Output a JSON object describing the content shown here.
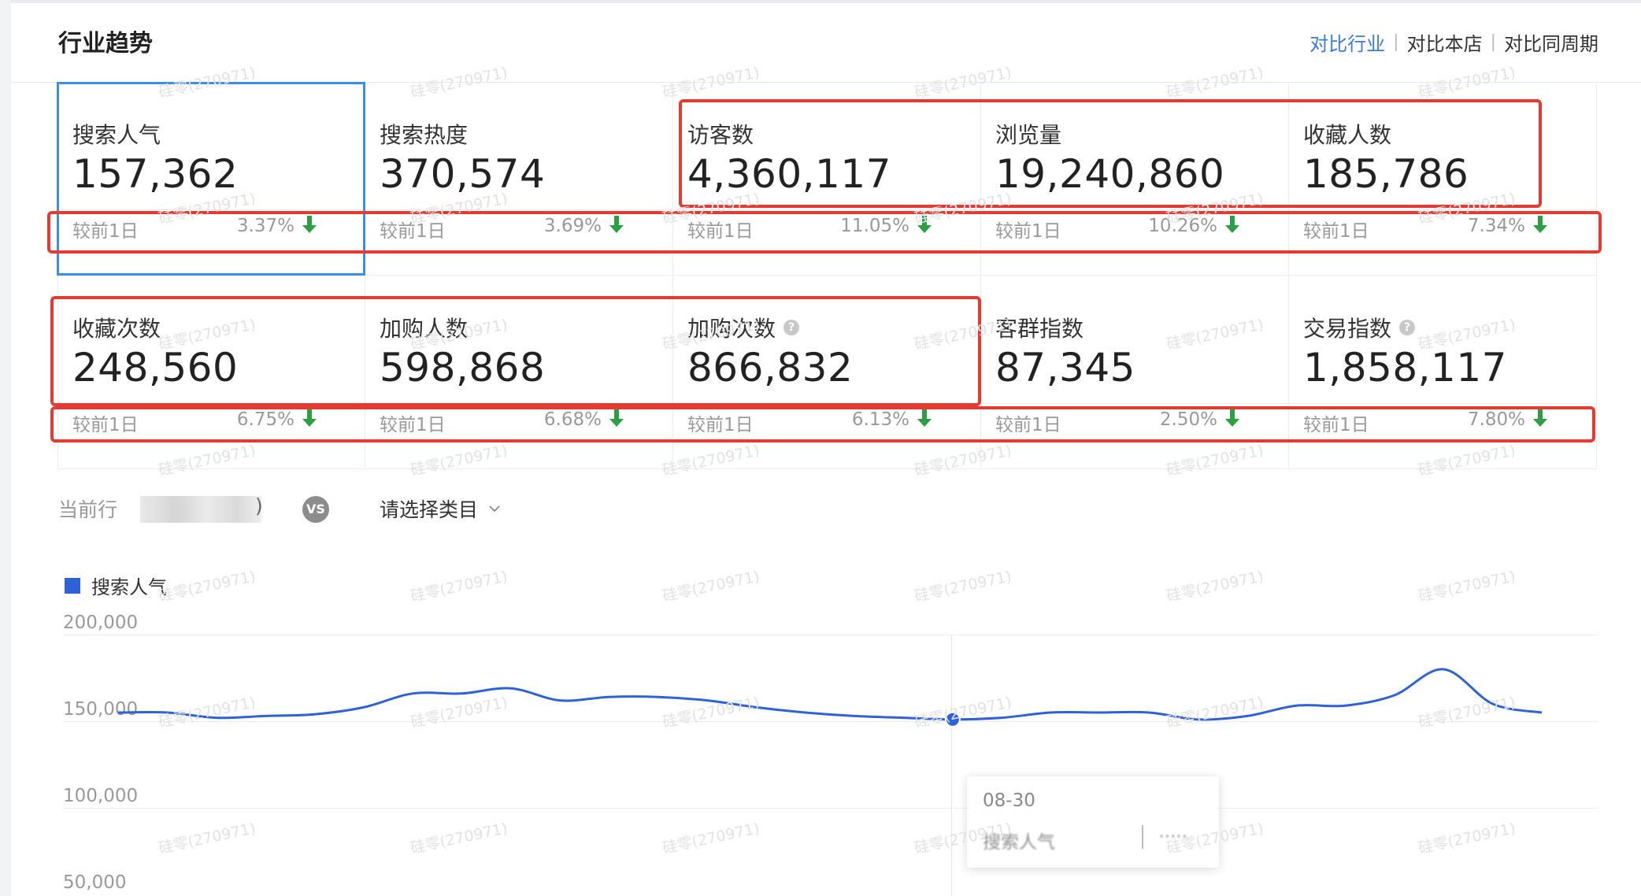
{
  "page": {
    "title": "行业趋势",
    "compare_options": [
      "对比行业",
      "对比本店",
      "对比同周期"
    ]
  },
  "metrics_row1": [
    {
      "label": "搜索人气",
      "value": "157,362",
      "compare": "较前1日",
      "pct": "3.37%",
      "help": false
    },
    {
      "label": "搜索热度",
      "value": "370,574",
      "compare": "较前1日",
      "pct": "3.69%",
      "help": false
    },
    {
      "label": "访客数",
      "value": "4,360,117",
      "compare": "较前1日",
      "pct": "11.05%",
      "help": false
    },
    {
      "label": "浏览量",
      "value": "19,240,860",
      "compare": "较前1日",
      "pct": "10.26%",
      "help": false
    },
    {
      "label": "收藏人数",
      "value": "185,786",
      "compare": "较前1日",
      "pct": "7.34%",
      "help": false
    }
  ],
  "metrics_row2": [
    {
      "label": "收藏次数",
      "value": "248,560",
      "compare": "较前1日",
      "pct": "6.75%",
      "help": false
    },
    {
      "label": "加购人数",
      "value": "598,868",
      "compare": "较前1日",
      "pct": "6.68%",
      "help": false
    },
    {
      "label": "加购次数",
      "value": "866,832",
      "compare": "较前1日",
      "pct": "6.13%",
      "help": true
    },
    {
      "label": "客群指数",
      "value": "87,345",
      "compare": "较前1日",
      "pct": "2.50%",
      "help": false
    },
    {
      "label": "交易指数",
      "value": "1,858,117",
      "compare": "较前1日",
      "pct": "7.80%",
      "help": true
    }
  ],
  "filter": {
    "current_label": "当前行",
    "close_paren": ")",
    "vs": "VS",
    "category_placeholder": "请选择类目"
  },
  "chart_data": {
    "type": "line",
    "series": [
      {
        "name": "搜索人气",
        "color": "#2f62d8",
        "values": [
          155000,
          155000,
          152000,
          153000,
          154000,
          158000,
          166000,
          166000,
          169000,
          162000,
          164000,
          164000,
          162000,
          158000,
          155000,
          153000,
          152000,
          151000,
          152000,
          155000,
          155000,
          155000,
          151000,
          153000,
          159000,
          159000,
          165000,
          180000,
          160000,
          155000
        ]
      }
    ],
    "y_ticks": [
      "200,000",
      "150,000",
      "100,000",
      "50,000"
    ],
    "ylim": [
      50000,
      200000
    ],
    "highlight_index": 17,
    "tooltip": {
      "date": "08-30",
      "series": "搜索人气"
    }
  },
  "colors": {
    "accent": "#3a7be0",
    "series": "#2f62d8",
    "down_arrow": "#2e9e45",
    "highlight_box": "#e33a32",
    "selected_box": "#3a8ee6"
  },
  "watermark": "硅零(270971)"
}
